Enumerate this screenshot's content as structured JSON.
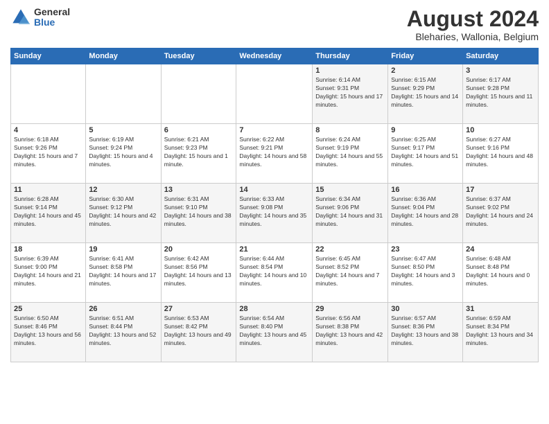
{
  "logo": {
    "general": "General",
    "blue": "Blue"
  },
  "header": {
    "month": "August 2024",
    "location": "Bleharies, Wallonia, Belgium"
  },
  "weekdays": [
    "Sunday",
    "Monday",
    "Tuesday",
    "Wednesday",
    "Thursday",
    "Friday",
    "Saturday"
  ],
  "weeks": [
    [
      {
        "day": "",
        "info": ""
      },
      {
        "day": "",
        "info": ""
      },
      {
        "day": "",
        "info": ""
      },
      {
        "day": "",
        "info": ""
      },
      {
        "day": "1",
        "info": "Sunrise: 6:14 AM\nSunset: 9:31 PM\nDaylight: 15 hours and 17 minutes."
      },
      {
        "day": "2",
        "info": "Sunrise: 6:15 AM\nSunset: 9:29 PM\nDaylight: 15 hours and 14 minutes."
      },
      {
        "day": "3",
        "info": "Sunrise: 6:17 AM\nSunset: 9:28 PM\nDaylight: 15 hours and 11 minutes."
      }
    ],
    [
      {
        "day": "4",
        "info": "Sunrise: 6:18 AM\nSunset: 9:26 PM\nDaylight: 15 hours and 7 minutes."
      },
      {
        "day": "5",
        "info": "Sunrise: 6:19 AM\nSunset: 9:24 PM\nDaylight: 15 hours and 4 minutes."
      },
      {
        "day": "6",
        "info": "Sunrise: 6:21 AM\nSunset: 9:23 PM\nDaylight: 15 hours and 1 minute."
      },
      {
        "day": "7",
        "info": "Sunrise: 6:22 AM\nSunset: 9:21 PM\nDaylight: 14 hours and 58 minutes."
      },
      {
        "day": "8",
        "info": "Sunrise: 6:24 AM\nSunset: 9:19 PM\nDaylight: 14 hours and 55 minutes."
      },
      {
        "day": "9",
        "info": "Sunrise: 6:25 AM\nSunset: 9:17 PM\nDaylight: 14 hours and 51 minutes."
      },
      {
        "day": "10",
        "info": "Sunrise: 6:27 AM\nSunset: 9:16 PM\nDaylight: 14 hours and 48 minutes."
      }
    ],
    [
      {
        "day": "11",
        "info": "Sunrise: 6:28 AM\nSunset: 9:14 PM\nDaylight: 14 hours and 45 minutes."
      },
      {
        "day": "12",
        "info": "Sunrise: 6:30 AM\nSunset: 9:12 PM\nDaylight: 14 hours and 42 minutes."
      },
      {
        "day": "13",
        "info": "Sunrise: 6:31 AM\nSunset: 9:10 PM\nDaylight: 14 hours and 38 minutes."
      },
      {
        "day": "14",
        "info": "Sunrise: 6:33 AM\nSunset: 9:08 PM\nDaylight: 14 hours and 35 minutes."
      },
      {
        "day": "15",
        "info": "Sunrise: 6:34 AM\nSunset: 9:06 PM\nDaylight: 14 hours and 31 minutes."
      },
      {
        "day": "16",
        "info": "Sunrise: 6:36 AM\nSunset: 9:04 PM\nDaylight: 14 hours and 28 minutes."
      },
      {
        "day": "17",
        "info": "Sunrise: 6:37 AM\nSunset: 9:02 PM\nDaylight: 14 hours and 24 minutes."
      }
    ],
    [
      {
        "day": "18",
        "info": "Sunrise: 6:39 AM\nSunset: 9:00 PM\nDaylight: 14 hours and 21 minutes."
      },
      {
        "day": "19",
        "info": "Sunrise: 6:41 AM\nSunset: 8:58 PM\nDaylight: 14 hours and 17 minutes."
      },
      {
        "day": "20",
        "info": "Sunrise: 6:42 AM\nSunset: 8:56 PM\nDaylight: 14 hours and 13 minutes."
      },
      {
        "day": "21",
        "info": "Sunrise: 6:44 AM\nSunset: 8:54 PM\nDaylight: 14 hours and 10 minutes."
      },
      {
        "day": "22",
        "info": "Sunrise: 6:45 AM\nSunset: 8:52 PM\nDaylight: 14 hours and 7 minutes."
      },
      {
        "day": "23",
        "info": "Sunrise: 6:47 AM\nSunset: 8:50 PM\nDaylight: 14 hours and 3 minutes."
      },
      {
        "day": "24",
        "info": "Sunrise: 6:48 AM\nSunset: 8:48 PM\nDaylight: 14 hours and 0 minutes."
      }
    ],
    [
      {
        "day": "25",
        "info": "Sunrise: 6:50 AM\nSunset: 8:46 PM\nDaylight: 13 hours and 56 minutes."
      },
      {
        "day": "26",
        "info": "Sunrise: 6:51 AM\nSunset: 8:44 PM\nDaylight: 13 hours and 52 minutes."
      },
      {
        "day": "27",
        "info": "Sunrise: 6:53 AM\nSunset: 8:42 PM\nDaylight: 13 hours and 49 minutes."
      },
      {
        "day": "28",
        "info": "Sunrise: 6:54 AM\nSunset: 8:40 PM\nDaylight: 13 hours and 45 minutes."
      },
      {
        "day": "29",
        "info": "Sunrise: 6:56 AM\nSunset: 8:38 PM\nDaylight: 13 hours and 42 minutes."
      },
      {
        "day": "30",
        "info": "Sunrise: 6:57 AM\nSunset: 8:36 PM\nDaylight: 13 hours and 38 minutes."
      },
      {
        "day": "31",
        "info": "Sunrise: 6:59 AM\nSunset: 8:34 PM\nDaylight: 13 hours and 34 minutes."
      }
    ]
  ]
}
